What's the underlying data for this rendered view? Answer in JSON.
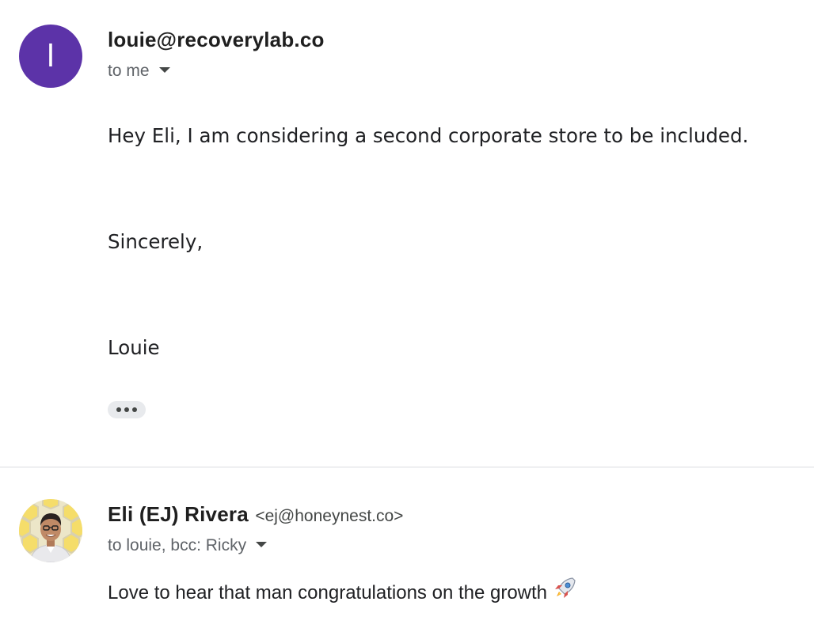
{
  "messages": [
    {
      "avatar_letter": "l",
      "avatar_color": "#5c33a8",
      "sender": "louie@recoverylab.co",
      "recipients": "to me",
      "body_lines": [
        "Hey Eli, I am considering a second corporate store to be included.",
        "Sincerely,",
        "Louie"
      ]
    },
    {
      "avatar_icon": "profile-photo-avatar",
      "sender_name": "Eli (EJ) Rivera",
      "sender_email": "<ej@honeynest.co>",
      "recipients": "to louie, bcc: Ricky",
      "body": "Love to hear that man congratulations on the growth",
      "body_icon": "rocket-icon"
    }
  ],
  "colors": {
    "divider": "#dadce0",
    "ellipsis_bg": "#e8eaed"
  }
}
